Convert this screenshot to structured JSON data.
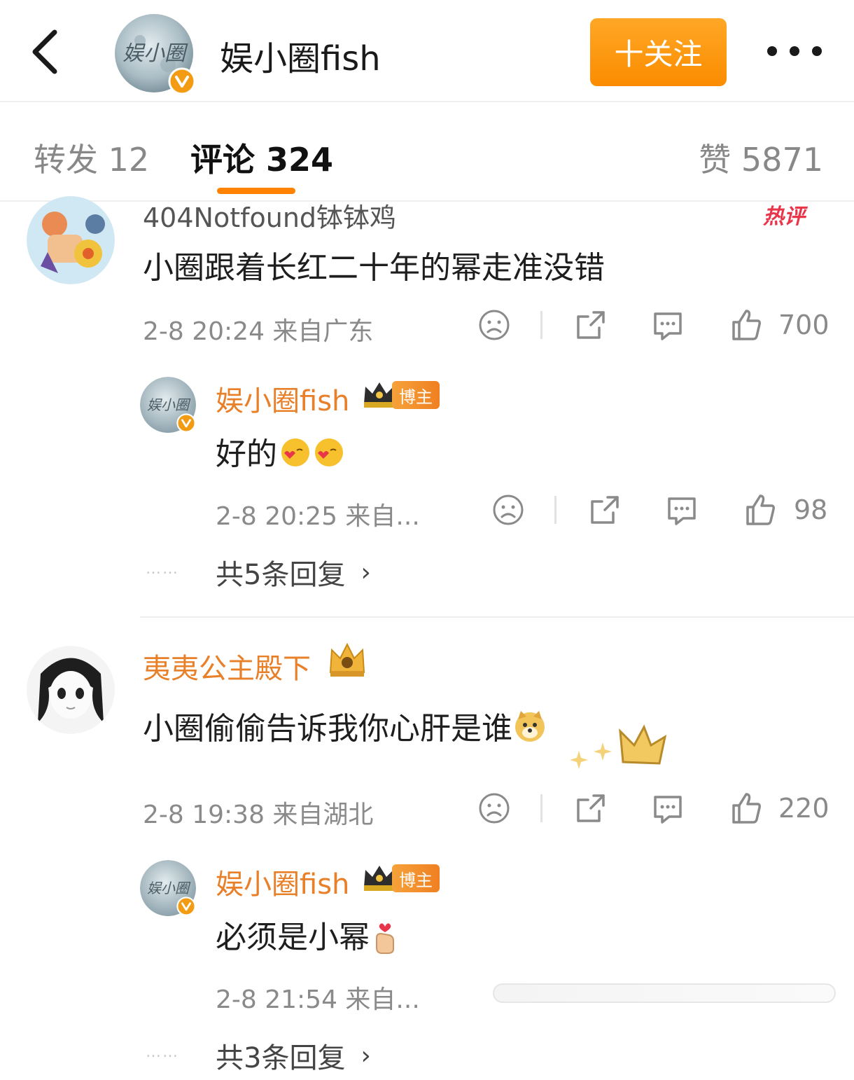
{
  "header": {
    "account_name": "娱小圈fish",
    "avatar_text": "娱小圈",
    "follow_label": "十关注",
    "icons": {
      "back": "back-arrow-icon",
      "more": "more-dots-icon",
      "verified": "verified-v-icon"
    }
  },
  "tabs": {
    "repost": "转发 12",
    "comments": "评论 324",
    "likes": "赞 5871"
  },
  "comments": [
    {
      "username": "404Notfound钵钵鸡",
      "hot_tag": "热评",
      "text": "小圈跟着长红二十年的幂走准没错",
      "meta": "2-8 20:24 来自广东",
      "likes": "700",
      "reply": {
        "username": "娱小圈fish",
        "badge": "博主",
        "text": "好的",
        "meta": "2-8 20:25 来自...",
        "likes": "98"
      },
      "more_replies": "共5条回复",
      "leader": "……"
    },
    {
      "username": "夷夷公主殿下",
      "text": "小圈偷偷告诉我你心肝是谁",
      "meta": "2-8 19:38 来自湖北",
      "likes": "220",
      "reply": {
        "username": "娱小圈fish",
        "badge": "博主",
        "text": "必须是小幂",
        "meta": "2-8 21:54 来自..."
      },
      "more_replies": "共3条回复",
      "leader": "……"
    }
  ],
  "colors": {
    "accent": "#ff8200",
    "follow_bg": "#fb8c00",
    "username_orange": "#e8802a",
    "hot_red": "#e8354a",
    "meta_gray": "#8a8a8a"
  },
  "progress_bar": {
    "value": 0
  }
}
